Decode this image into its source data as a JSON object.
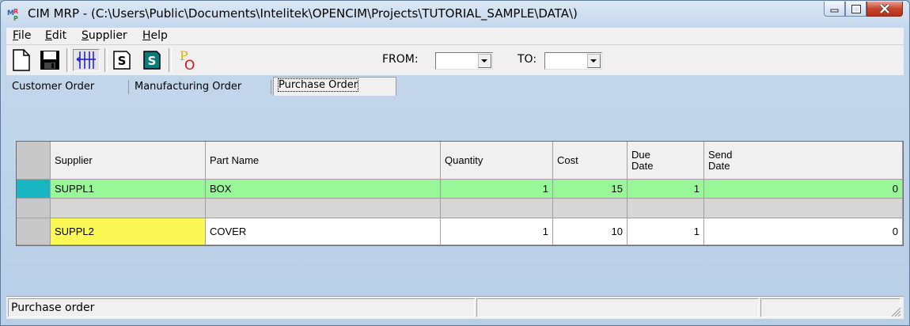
{
  "window": {
    "title": "CIM MRP - (C:\\Users\\Public\\Documents\\Intelitek\\OPENCIM\\Projects\\TUTORIAL_SAMPLE\\DATA\\)"
  },
  "menu": {
    "file": {
      "label": "File",
      "mnemonic": "F",
      "rest": "ile"
    },
    "edit": {
      "label": "Edit",
      "mnemonic": "E",
      "rest": "dit"
    },
    "supplier": {
      "label": "Supplier",
      "mnemonic": "S",
      "rest": "upplier"
    },
    "help": {
      "label": "Help",
      "mnemonic": "H",
      "rest": "elp"
    }
  },
  "toolbar": {
    "from_label": "FROM:",
    "from_value": "",
    "to_label": "TO:",
    "to_value": "",
    "po_letters": [
      "P",
      "O"
    ],
    "s_letter": "S"
  },
  "tabs": [
    {
      "label": "Customer Order",
      "active": false
    },
    {
      "label": "Manufacturing Order",
      "active": false
    },
    {
      "label": "Purchase Order",
      "active": true
    }
  ],
  "grid": {
    "columns": [
      "Supplier",
      "Part Name",
      "Quantity",
      "Cost",
      "Due Date",
      "Send Date"
    ],
    "columns_display": [
      "Supplier",
      "Part Name",
      "Quantity",
      "Cost",
      "Due\nDate",
      "Send\nDate"
    ],
    "rows": [
      {
        "supplier": "SUPPL1",
        "part_name": "BOX",
        "quantity": "1",
        "cost": "15",
        "due_date": "1",
        "send_date": "0",
        "style": "selected"
      },
      {
        "supplier": "",
        "part_name": "",
        "quantity": "",
        "cost": "",
        "due_date": "",
        "send_date": "",
        "style": "empty"
      },
      {
        "supplier": "SUPPL2",
        "part_name": "COVER",
        "quantity": "1",
        "cost": "10",
        "due_date": "1",
        "send_date": "0",
        "style": "highlight-supplier"
      }
    ]
  },
  "status": {
    "text": "Purchase order"
  },
  "colors": {
    "selected_row": "#98f898",
    "selected_indicator": "#18b6c2",
    "supplier_highlight": "#fbf855",
    "empty_row": "#d6d6d6"
  }
}
